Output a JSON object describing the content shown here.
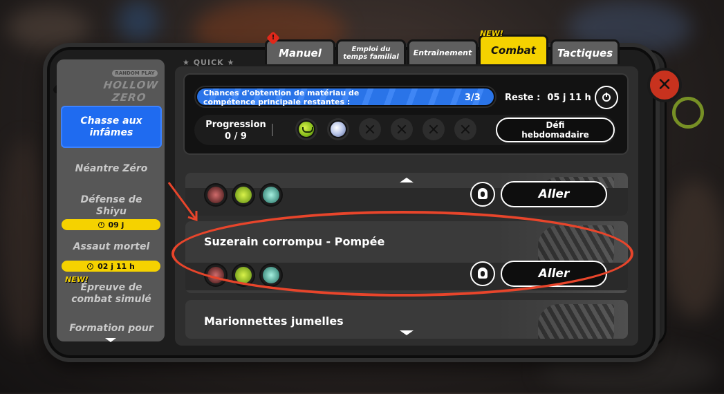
{
  "tabs": [
    {
      "label": "Manuel",
      "active": false,
      "alert": "!"
    },
    {
      "label": "Emploi du\ntemps familial",
      "active": false
    },
    {
      "label": "Entraînement",
      "active": false
    },
    {
      "label": "Combat",
      "active": true,
      "badge": "NEW!"
    },
    {
      "label": "Tactiques",
      "active": false
    }
  ],
  "logo": {
    "sub": "RANDOM PLAY",
    "main": "HOLLOW ZERO"
  },
  "quick_label": "★ QUICK ★",
  "sidebar": {
    "items": [
      {
        "label": "Chasse aux\ninfâmes",
        "active": true
      },
      {
        "label": "Néantre Zéro"
      },
      {
        "label": "Défense de\nShiyu",
        "timer": "09 j"
      },
      {
        "label": "Assaut mortel",
        "timer": "02 j 11 h"
      },
      {
        "label": "Épreuve de\ncombat simulé",
        "badge": "NEW!"
      },
      {
        "label": "Formation pour"
      }
    ]
  },
  "summary": {
    "chances_label": "Chances d'obtention de matériau de\ncompétence principale restantes :",
    "chances_count": "3/3",
    "chances_fraction": 1.0,
    "remaining_label": "Reste :",
    "remaining_value": "05 j 11 h",
    "progression_label": "Progression",
    "progression_value": "0 / 9",
    "progress_slots": [
      "green",
      "silver",
      "empty",
      "empty",
      "empty",
      "empty"
    ],
    "weekly_button": "Défi\nhebdomadaire"
  },
  "cards": [
    {
      "title": "",
      "go_label": "Aller",
      "icons": [
        "red",
        "green",
        "teal"
      ]
    },
    {
      "title": "Suzerain corrompu - Pompée",
      "go_label": "Aller",
      "icons": [
        "red",
        "green",
        "teal"
      ]
    },
    {
      "title": "Marionnettes jumelles"
    }
  ],
  "colors": {
    "accent_yellow": "#f5d200",
    "active_blue": "#1f6bf0",
    "highlight_red": "#e8452b",
    "exit_red": "#c8321e"
  }
}
